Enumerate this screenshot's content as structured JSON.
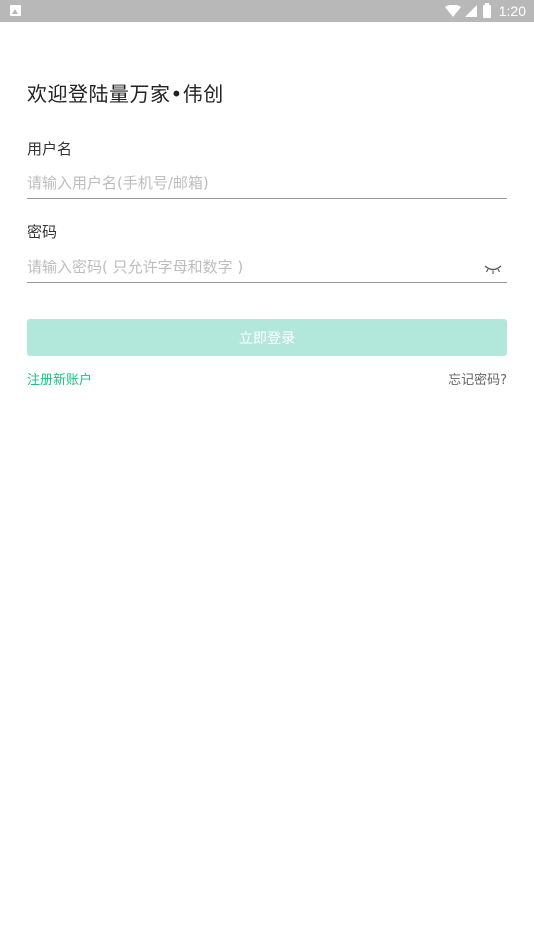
{
  "status_bar": {
    "time": "1:20",
    "notification_icon": "image-notification-icon",
    "wifi_icon": "wifi-icon",
    "signal_icon": "signal-icon",
    "battery_icon": "battery-icon"
  },
  "title": "欢迎登陆量万家•伟创",
  "username": {
    "label": "用户名",
    "placeholder": "请输入用户名(手机号/邮箱)",
    "value": ""
  },
  "password": {
    "label": "密码",
    "placeholder": "请输入密码( 只允许字母和数字 )",
    "value": "",
    "toggle_icon": "eye-closed-icon"
  },
  "login_button": {
    "label": "立即登录"
  },
  "links": {
    "register": "注册新账户",
    "forgot": "忘记密码?"
  },
  "colors": {
    "status_bar": "#b8b8b8",
    "button_bg": "#b2e8dc",
    "accent_green": "#1dbf80",
    "divider": "#999999"
  }
}
